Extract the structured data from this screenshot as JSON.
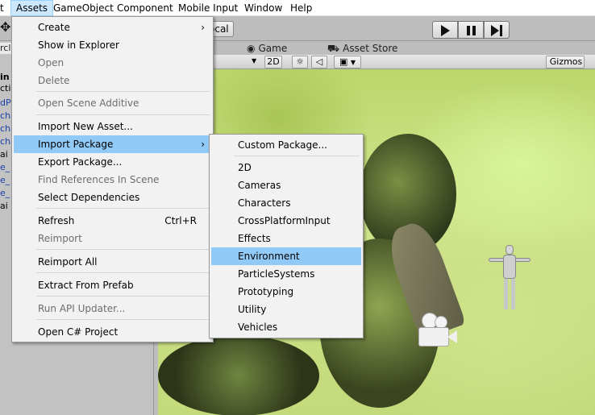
{
  "menubar": {
    "items": [
      {
        "label": "t"
      },
      {
        "label": "Assets"
      },
      {
        "label": "GameObject"
      },
      {
        "label": "Component"
      },
      {
        "label": "Mobile Input"
      },
      {
        "label": "Window"
      },
      {
        "label": "Help"
      }
    ]
  },
  "toolbar": {
    "pivot_toggle": "ocal"
  },
  "left_panel": {
    "search_fragment": "rcl",
    "items": [
      "in",
      "cti",
      "dP",
      "cha",
      "cha",
      "cha",
      "ai",
      "e_",
      "e_",
      "e_",
      "ai"
    ]
  },
  "tabs": {
    "game": "Game",
    "asset_store": "Asset Store"
  },
  "scene_toolbar": {
    "mode_2d": "2D",
    "gizmos": "Gizmos"
  },
  "assets_menu": {
    "items": [
      {
        "label": "Create",
        "disabled": false,
        "submenu": true
      },
      {
        "label": "Show in Explorer",
        "disabled": false
      },
      {
        "label": "Open",
        "disabled": true
      },
      {
        "label": "Delete",
        "disabled": true
      },
      {
        "label": "Open Scene Additive",
        "disabled": true
      },
      {
        "label": "Import New Asset...",
        "disabled": false
      },
      {
        "label": "Import Package",
        "disabled": false,
        "submenu": true,
        "highlighted": true
      },
      {
        "label": "Export Package...",
        "disabled": false
      },
      {
        "label": "Find References In Scene",
        "disabled": true
      },
      {
        "label": "Select Dependencies",
        "disabled": false
      },
      {
        "label": "Refresh",
        "disabled": false,
        "shortcut": "Ctrl+R"
      },
      {
        "label": "Reimport",
        "disabled": true
      },
      {
        "label": "Reimport All",
        "disabled": false
      },
      {
        "label": "Extract From Prefab",
        "disabled": false
      },
      {
        "label": "Run API Updater...",
        "disabled": true
      },
      {
        "label": "Open C# Project",
        "disabled": false
      }
    ]
  },
  "import_package_menu": {
    "items": [
      {
        "label": "Custom Package..."
      },
      {
        "label": "2D"
      },
      {
        "label": "Cameras"
      },
      {
        "label": "Characters"
      },
      {
        "label": "CrossPlatformInput"
      },
      {
        "label": "Effects"
      },
      {
        "label": "Environment",
        "highlighted": true
      },
      {
        "label": "ParticleSystems"
      },
      {
        "label": "Prototyping"
      },
      {
        "label": "Utility"
      },
      {
        "label": "Vehicles"
      }
    ]
  },
  "colors": {
    "menu_highlight": "#91c9f7",
    "menubar_active": "#cce8ff",
    "disabled_text": "#6d6d6d"
  }
}
